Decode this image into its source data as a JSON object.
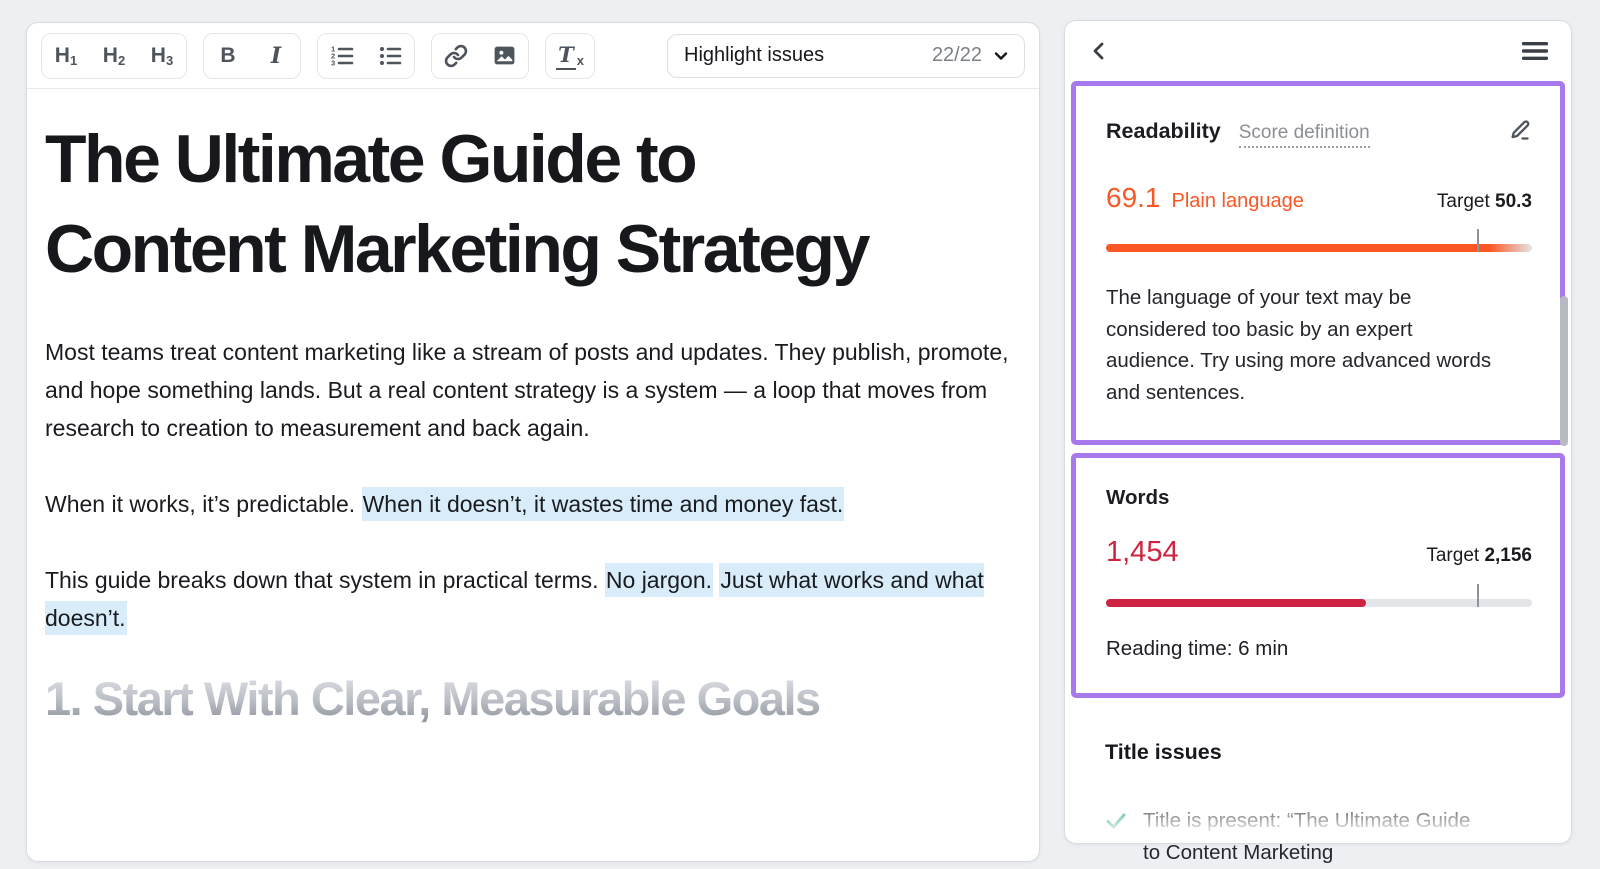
{
  "colors": {
    "accent_purple": "#a879ec",
    "readability_orange": "#fa5724",
    "words_red": "#ce2342",
    "check_green": "#12a26d",
    "highlight_blue": "#d8ecf9",
    "page_background": "#edeff3"
  },
  "editor": {
    "toolbar": {
      "h1": {
        "main": "H",
        "sub": "1"
      },
      "h2": {
        "main": "H",
        "sub": "2"
      },
      "h3": {
        "main": "H",
        "sub": "3"
      },
      "bold": "B",
      "italic": "I",
      "clear_formatting": {
        "main": "T",
        "sub": "x"
      },
      "highlight_label": "Highlight issues",
      "highlight_count": "22/22"
    },
    "document": {
      "title": "The Ultimate Guide to Content Marketing Strategy",
      "paragraphs": [
        [
          {
            "text": "Most teams treat content marketing like a stream of posts and updates. They publish, promote, and hope something lands. But a real content strategy is a system — a loop that moves from research to creation to measurement and back again.",
            "highlight": false
          }
        ],
        [
          {
            "text": "When it works, it’s predictable. ",
            "highlight": false
          },
          {
            "text": "When it doesn’t, it wastes time and money fast.",
            "highlight": true
          }
        ],
        [
          {
            "text": "This guide breaks down that system in practical terms. ",
            "highlight": false
          },
          {
            "text": "No jargon.",
            "highlight": true
          },
          {
            "text": " ",
            "highlight": false
          },
          {
            "text": "Just what works and what doesn’t.",
            "highlight": true
          }
        ]
      ],
      "next_heading": "1. Start With Clear, Measurable Goals"
    }
  },
  "panel": {
    "readability": {
      "title": "Readability",
      "score_definition": "Score definition",
      "score": "69.1",
      "score_label": "Plain language",
      "target_label": "Target",
      "target_value": "50.3",
      "bar": {
        "fill_percent": 100,
        "tick_percent": 87
      },
      "description": "The language of your text may be considered too basic by an expert audience. Try using more advanced words and sentences."
    },
    "words": {
      "title": "Words",
      "count": "1,454",
      "target_label": "Target",
      "target_value": "2,156",
      "bar": {
        "fill_percent": 61,
        "tick_percent": 87
      },
      "reading_time": "Reading time: 6 min"
    },
    "title_issues": {
      "title": "Title issues",
      "items": [
        {
          "status": "pass",
          "text": "Title is present: “The Ultimate Guide to Content Marketing"
        }
      ]
    }
  }
}
